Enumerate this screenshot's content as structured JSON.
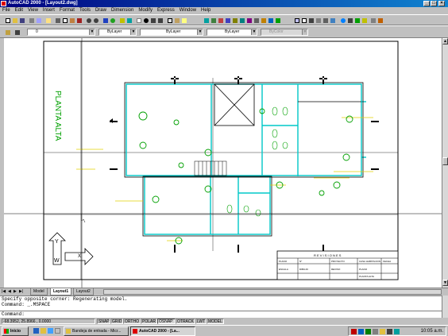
{
  "window": {
    "title": "AutoCAD 2000 - [Layout2.dwg]",
    "controls": [
      "_",
      "□",
      "×"
    ]
  },
  "menu": [
    "File",
    "Edit",
    "View",
    "Insert",
    "Format",
    "Tools",
    "Draw",
    "Dimension",
    "Modify",
    "Express",
    "Window",
    "Help"
  ],
  "properties_bar": {
    "layer_value": "0",
    "color_value": "ByLayer",
    "linetype_value": "ByLayer",
    "lineweight_value": "ByLayer",
    "plotstyle_value": "ByColor"
  },
  "drawing": {
    "floor_label": "PLANTA ALTA",
    "title_block_header": "R E V I S I O N E S",
    "title_block_cells": [
      "PLANO",
      "N°",
      "PROYECTO",
      "CASA HABITACION",
      "FECHA",
      "ESCALA",
      "DIBUJO",
      "REVISO",
      "PLANO",
      "PLANTA ALTA"
    ],
    "ucs_labels": [
      "Y",
      "X",
      "W"
    ]
  },
  "tabs": [
    "Model",
    "Layout1",
    "Layout2"
  ],
  "active_tab": "Layout1",
  "command": {
    "lines": [
      "Specify opposite corner: Regenerating model.",
      "Command: _.MSPACE",
      "Command:"
    ]
  },
  "status_bar": {
    "coords": "-68.3952, 25.8966 , 0.0000",
    "toggles": [
      "SNAP",
      "GRID",
      "ORTHO",
      "POLAR",
      "OSNAP",
      "OTRACK",
      "LWT",
      "MODEL"
    ]
  },
  "taskbar": {
    "start_label": "Inicio",
    "tasks": [
      "Bandeja de entrada - Micr...",
      "AutoCAD 2000 - [La..."
    ],
    "clock": "10:05 a.m."
  },
  "colors": {
    "title_bar": "#000080",
    "cad_cyan": "#00c8c8",
    "cad_green": "#00a000",
    "cad_yellow": "#e0d000"
  }
}
